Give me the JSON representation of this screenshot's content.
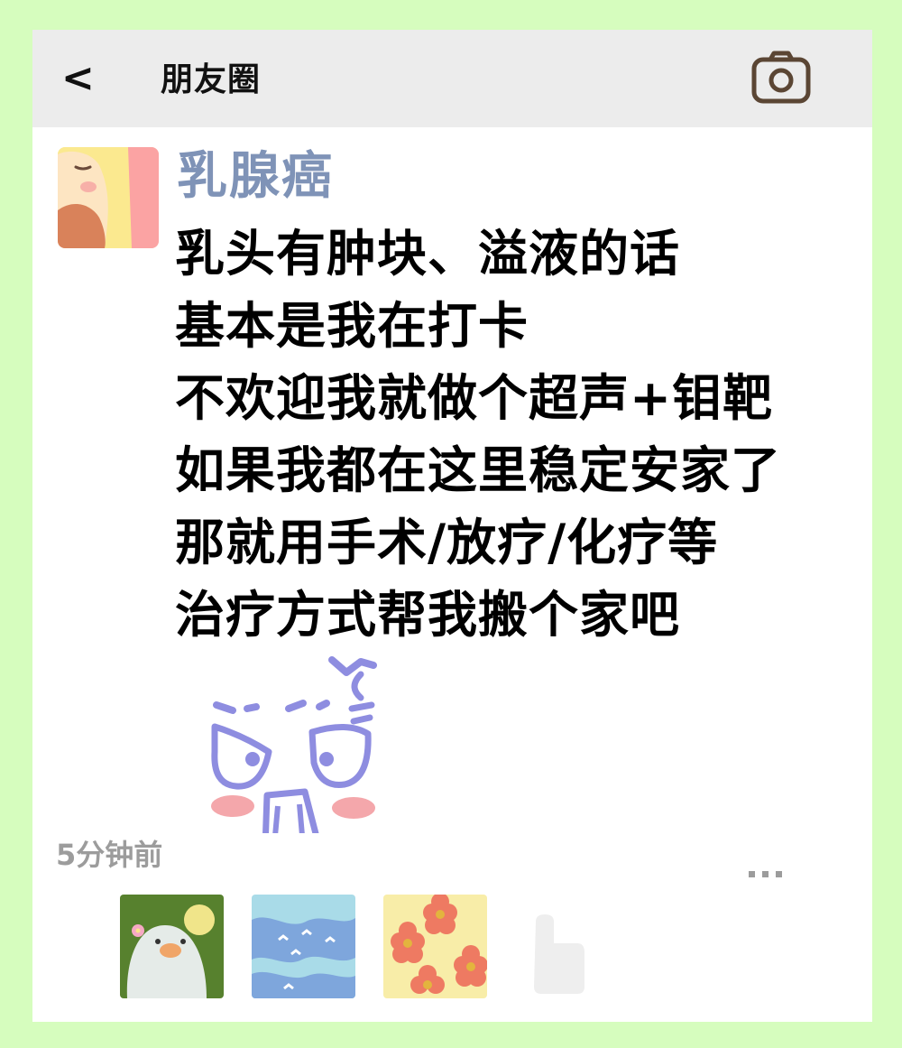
{
  "header": {
    "back_label": "<",
    "title": "朋友圈",
    "camera_icon": "camera-icon"
  },
  "post": {
    "username": "乳腺癌",
    "lines": [
      "乳头有肿块、溢液的话",
      "基本是我在打卡",
      "不欢迎我就做个超声+钼靶",
      "如果我都在这里稳定安家了",
      "那就用手术/放疗/化疗等",
      "治疗方式帮我搬个家吧"
    ],
    "sticker": "angry-face-sticker",
    "time": "5分钟前",
    "more_icon": "more-dots-icon"
  },
  "likes": {
    "avatars": [
      "penguin-avatar",
      "sea-birds-avatar",
      "flowers-avatar"
    ],
    "like_icon": "thumbs-up-icon"
  },
  "colors": {
    "background": "#d6fdbe",
    "header": "#ececec",
    "username": "#7f93b7",
    "time": "#9c9c9c"
  }
}
